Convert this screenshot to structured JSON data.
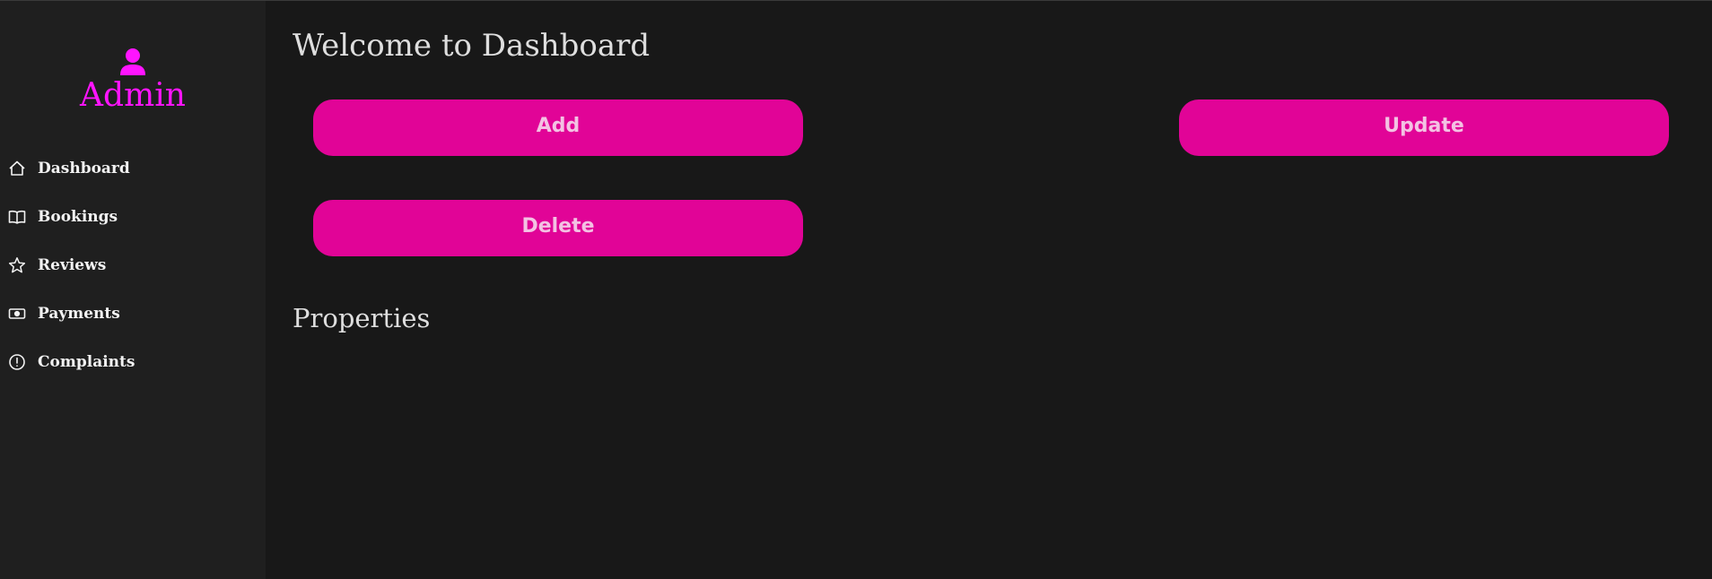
{
  "sidebar": {
    "profile": {
      "icon": "user-icon",
      "name": "Admin",
      "accent_color": "#ff14ff"
    },
    "items": [
      {
        "label": "Dashboard",
        "icon": "home-icon"
      },
      {
        "label": "Bookings",
        "icon": "book-icon"
      },
      {
        "label": "Reviews",
        "icon": "star-icon"
      },
      {
        "label": "Payments",
        "icon": "cash-icon"
      },
      {
        "label": "Complaints",
        "icon": "alert-circle-icon"
      }
    ]
  },
  "main": {
    "title": "Welcome to Dashboard",
    "actions": {
      "add_label": "Add",
      "update_label": "Update",
      "delete_label": "Delete",
      "button_color": "#e10497"
    },
    "section_title": "Properties"
  }
}
